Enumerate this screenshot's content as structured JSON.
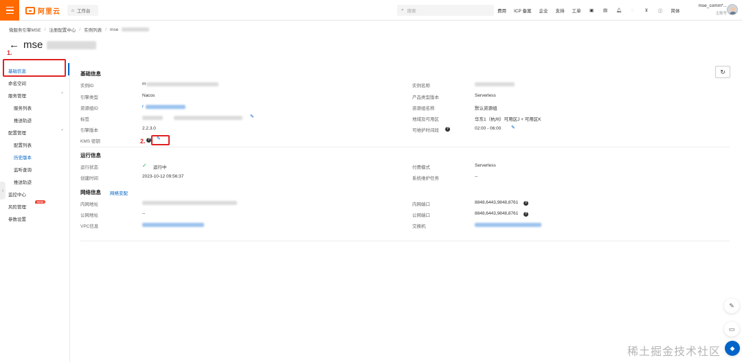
{
  "header": {
    "logo_text": "阿里云",
    "workbench_label": "工作台",
    "search_placeholder": "搜索",
    "nav": [
      "费用",
      "ICP 备案",
      "企业",
      "支持",
      "工单"
    ],
    "lang_label": "简体",
    "user_name": "mse_comm*...",
    "user_role": "主账号"
  },
  "breadcrumb": [
    "微服务引擎MSE",
    "注册配置中心",
    "实例列表",
    "mse"
  ],
  "page_title": "mse",
  "annotations": {
    "step1": "1.",
    "step2": "2."
  },
  "sidebar": {
    "items": [
      {
        "label": "基础信息"
      },
      {
        "label": "命名空间"
      },
      {
        "label": "服务管理"
      },
      {
        "label": "服务列表"
      },
      {
        "label": "推送轨迹"
      },
      {
        "label": "配置管理"
      },
      {
        "label": "配置列表"
      },
      {
        "label": "历史版本"
      },
      {
        "label": "监听查询"
      },
      {
        "label": "推送轨迹"
      },
      {
        "label": "监控中心"
      },
      {
        "label": "风险管理"
      },
      {
        "label": "参数设置"
      }
    ],
    "new_badge": "New"
  },
  "basic": {
    "title": "基础信息",
    "instance_id_label": "实例ID",
    "instance_id_value": "m",
    "engine_type_label": "引擎类型",
    "engine_type_value": "Nacos",
    "resource_group_id_label": "资源组ID",
    "resource_group_id_value": "r",
    "tag_label": "标签",
    "engine_version_label": "引擎版本",
    "engine_version_value": "2.2.3.0",
    "kms_label": "KMS 密钥",
    "instance_name_label": "实例名称",
    "product_version_label": "产品类型版本",
    "product_version_value": "Serverless",
    "resource_group_name_label": "资源组名称",
    "resource_group_name_value": "默认资源组",
    "region_label": "地域及可用区",
    "region_value": "华东1（杭州）可用区J + 可用区K",
    "maintenance_label": "可维护时间段",
    "maintenance_value": "02:00 - 06:00"
  },
  "runtime": {
    "title": "运行信息",
    "status_label": "运行状态",
    "status_value": "运行中",
    "created_label": "创建时间",
    "created_value": "2023-10-12 09:56:37",
    "billing_label": "付费模式",
    "billing_value": "Serverless",
    "maintenance_task_label": "系统维护任务",
    "maintenance_task_value": "--"
  },
  "network": {
    "title": "网络信息",
    "change_link": "网络变配",
    "private_addr_label": "内网地址",
    "private_addr_value": "mse-…-nacos-…",
    "public_addr_label": "公网地址",
    "public_addr_value": "--",
    "vpc_label": "VPC信息",
    "private_port_label": "内网端口",
    "private_port_value": "8848,6443,9848,8761",
    "public_port_label": "公网端口",
    "public_port_value": "8848,6443,9848,8761",
    "vswitch_label": "交换机"
  },
  "watermark": "稀土掘金技术社区",
  "colors": {
    "brand": "#ff6a00",
    "accent": "#0064c8",
    "annotation": "#e02020",
    "success": "#1ea84d"
  }
}
